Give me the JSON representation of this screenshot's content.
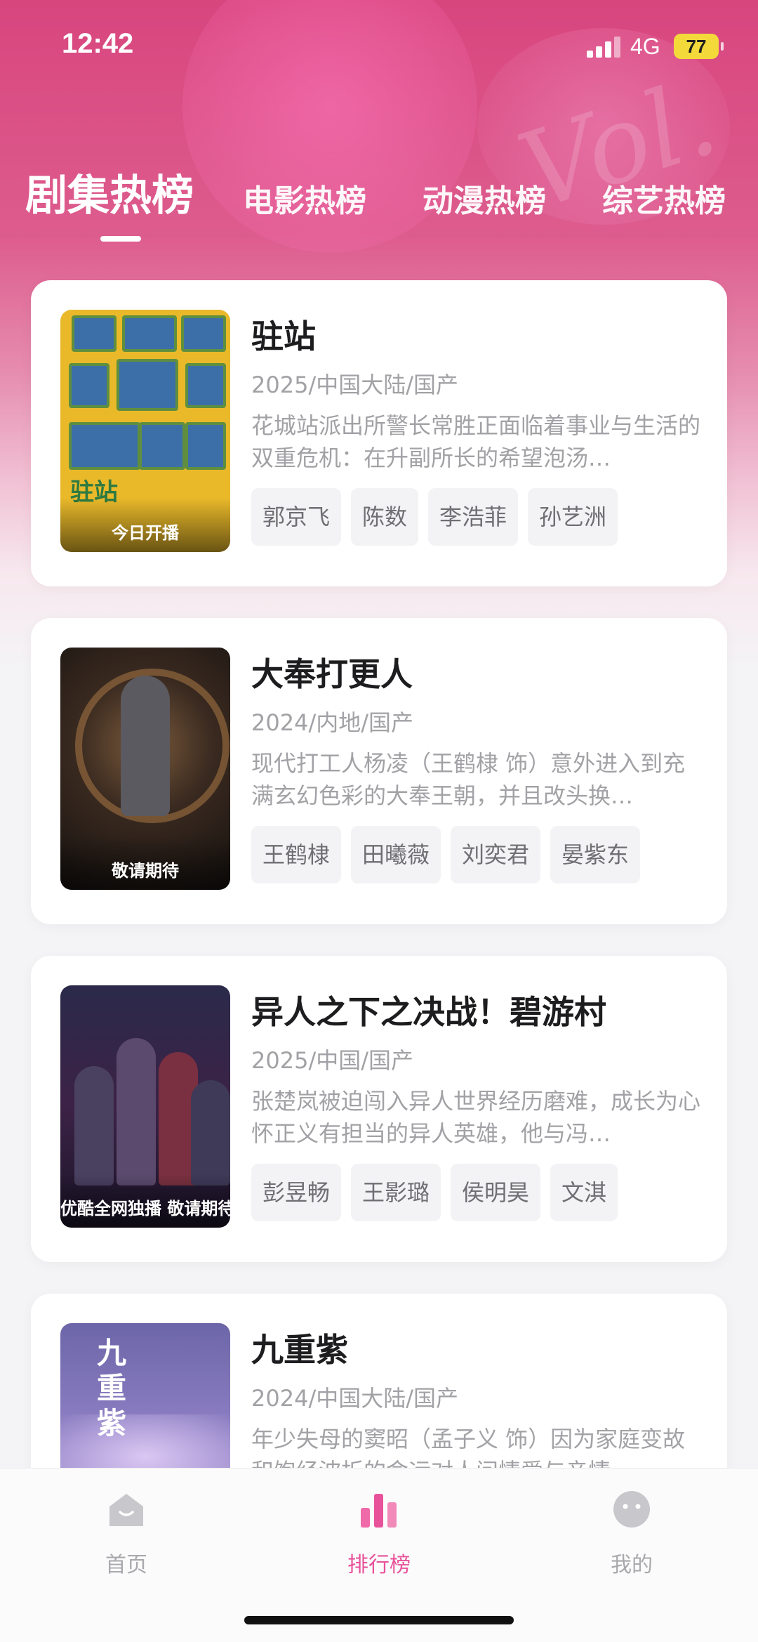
{
  "status_bar": {
    "time": "12:42",
    "network": "4G",
    "battery": "77"
  },
  "category_tabs": [
    {
      "label": "剧集热榜",
      "active": true
    },
    {
      "label": "电影热榜",
      "active": false
    },
    {
      "label": "动漫热榜",
      "active": false
    },
    {
      "label": "综艺热榜",
      "active": false
    }
  ],
  "shows": [
    {
      "title": "驻站",
      "meta": "2025/中国大陆/国产",
      "description": "花城站派出所警长常胜正面临着事业与生活的双重危机：在升副所长的希望泡汤…",
      "poster_caption": "今日开播",
      "poster_stamp": "驻站",
      "cast": [
        "郭京飞",
        "陈数",
        "李浩菲",
        "孙艺洲"
      ]
    },
    {
      "title": "大奉打更人",
      "meta": "2024/内地/国产",
      "description": "现代打工人杨凌（王鹤棣 饰）意外进入到充满玄幻色彩的大奉王朝，并且改头换…",
      "poster_caption": "敬请期待",
      "cast": [
        "王鹤棣",
        "田曦薇",
        "刘奕君",
        "晏紫东"
      ]
    },
    {
      "title": "异人之下之决战！碧游村",
      "meta": "2025/中国/国产",
      "description": "张楚岚被迫闯入异人世界经历磨难，成长为心怀正义有担当的异人英雄，他与冯…",
      "poster_caption": "优酷全网独播 敬请期待",
      "cast": [
        "彭昱畅",
        "王影璐",
        "侯明昊",
        "文淇"
      ]
    },
    {
      "title": "九重紫",
      "meta": "2024/中国大陆/国产",
      "description": "年少失母的窦昭（孟子义 饰）因为家庭变故和饱经波折的命运对人间情爱与亲情…",
      "poster_stamp": "九重紫",
      "cast": []
    }
  ],
  "bottom_nav": [
    {
      "label": "首页",
      "icon": "home-icon",
      "active": false
    },
    {
      "label": "排行榜",
      "icon": "ranking-icon",
      "active": true
    },
    {
      "label": "我的",
      "icon": "profile-icon",
      "active": false
    }
  ],
  "colors": {
    "accent": "#e8529a",
    "header_pink": "#d8467e",
    "battery_yellow": "#f4d93b"
  }
}
